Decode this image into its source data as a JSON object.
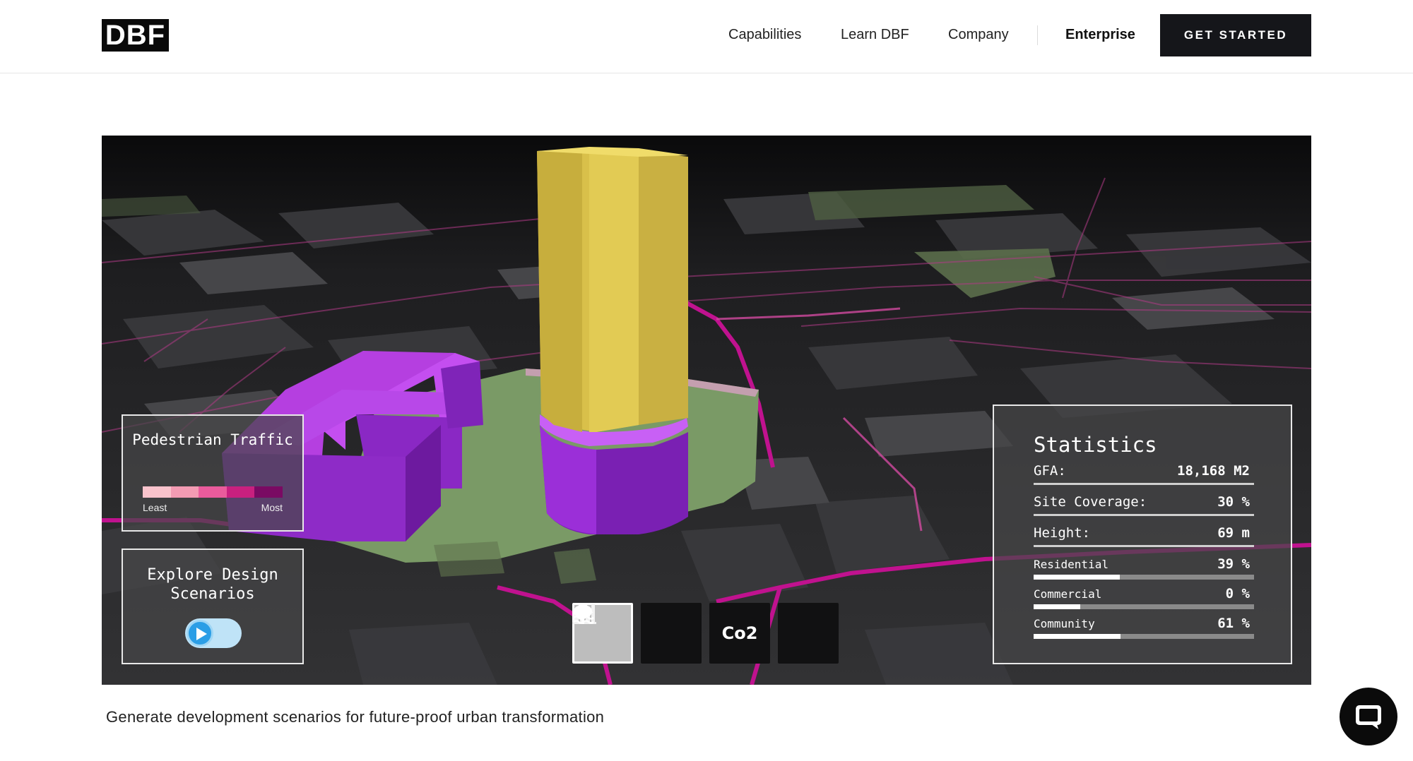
{
  "header": {
    "logo": "DBF",
    "nav": [
      {
        "label": "Capabilities"
      },
      {
        "label": "Learn DBF"
      },
      {
        "label": "Company"
      },
      {
        "label": "Enterprise"
      }
    ],
    "cta_label": "GET STARTED"
  },
  "hero": {
    "pedestrian": {
      "title": "Pedestrian Traffic",
      "least_label": "Least",
      "most_label": "Most",
      "scale_colors": [
        "#f9c3cc",
        "#f39bb3",
        "#ea5b9c",
        "#c8207f",
        "#7a0a63"
      ]
    },
    "explore": {
      "title": "Explore Design Scenarios",
      "toggle_on": false
    },
    "tools": [
      {
        "icon": "buildings-icon",
        "active": true
      },
      {
        "icon": "tree-icon",
        "active": false
      },
      {
        "icon": "co2-icon",
        "label": "Co2",
        "active": false
      },
      {
        "icon": "flood-icon",
        "active": false
      }
    ],
    "statistics": {
      "title": "Statistics",
      "gfa_label": "GFA:",
      "gfa_value": "18,168 M2",
      "site_coverage_label": "Site Coverage:",
      "site_coverage_value": "30 %",
      "height_label": "Height:",
      "height_value": "69 m",
      "uses": [
        {
          "label": "Residential",
          "value": "39 %",
          "fraction": 0.39
        },
        {
          "label": "Commercial",
          "value": "0 %",
          "fraction": 0.21
        },
        {
          "label": "Community",
          "value": "61 %",
          "fraction": 0.395
        }
      ]
    },
    "colors": {
      "tower": "#d9c04a",
      "podium": "#9b2fd8",
      "site": "#7a9a66",
      "road_highlight": "#c0128f"
    }
  },
  "caption": "Generate development scenarios for future-proof urban transformation"
}
